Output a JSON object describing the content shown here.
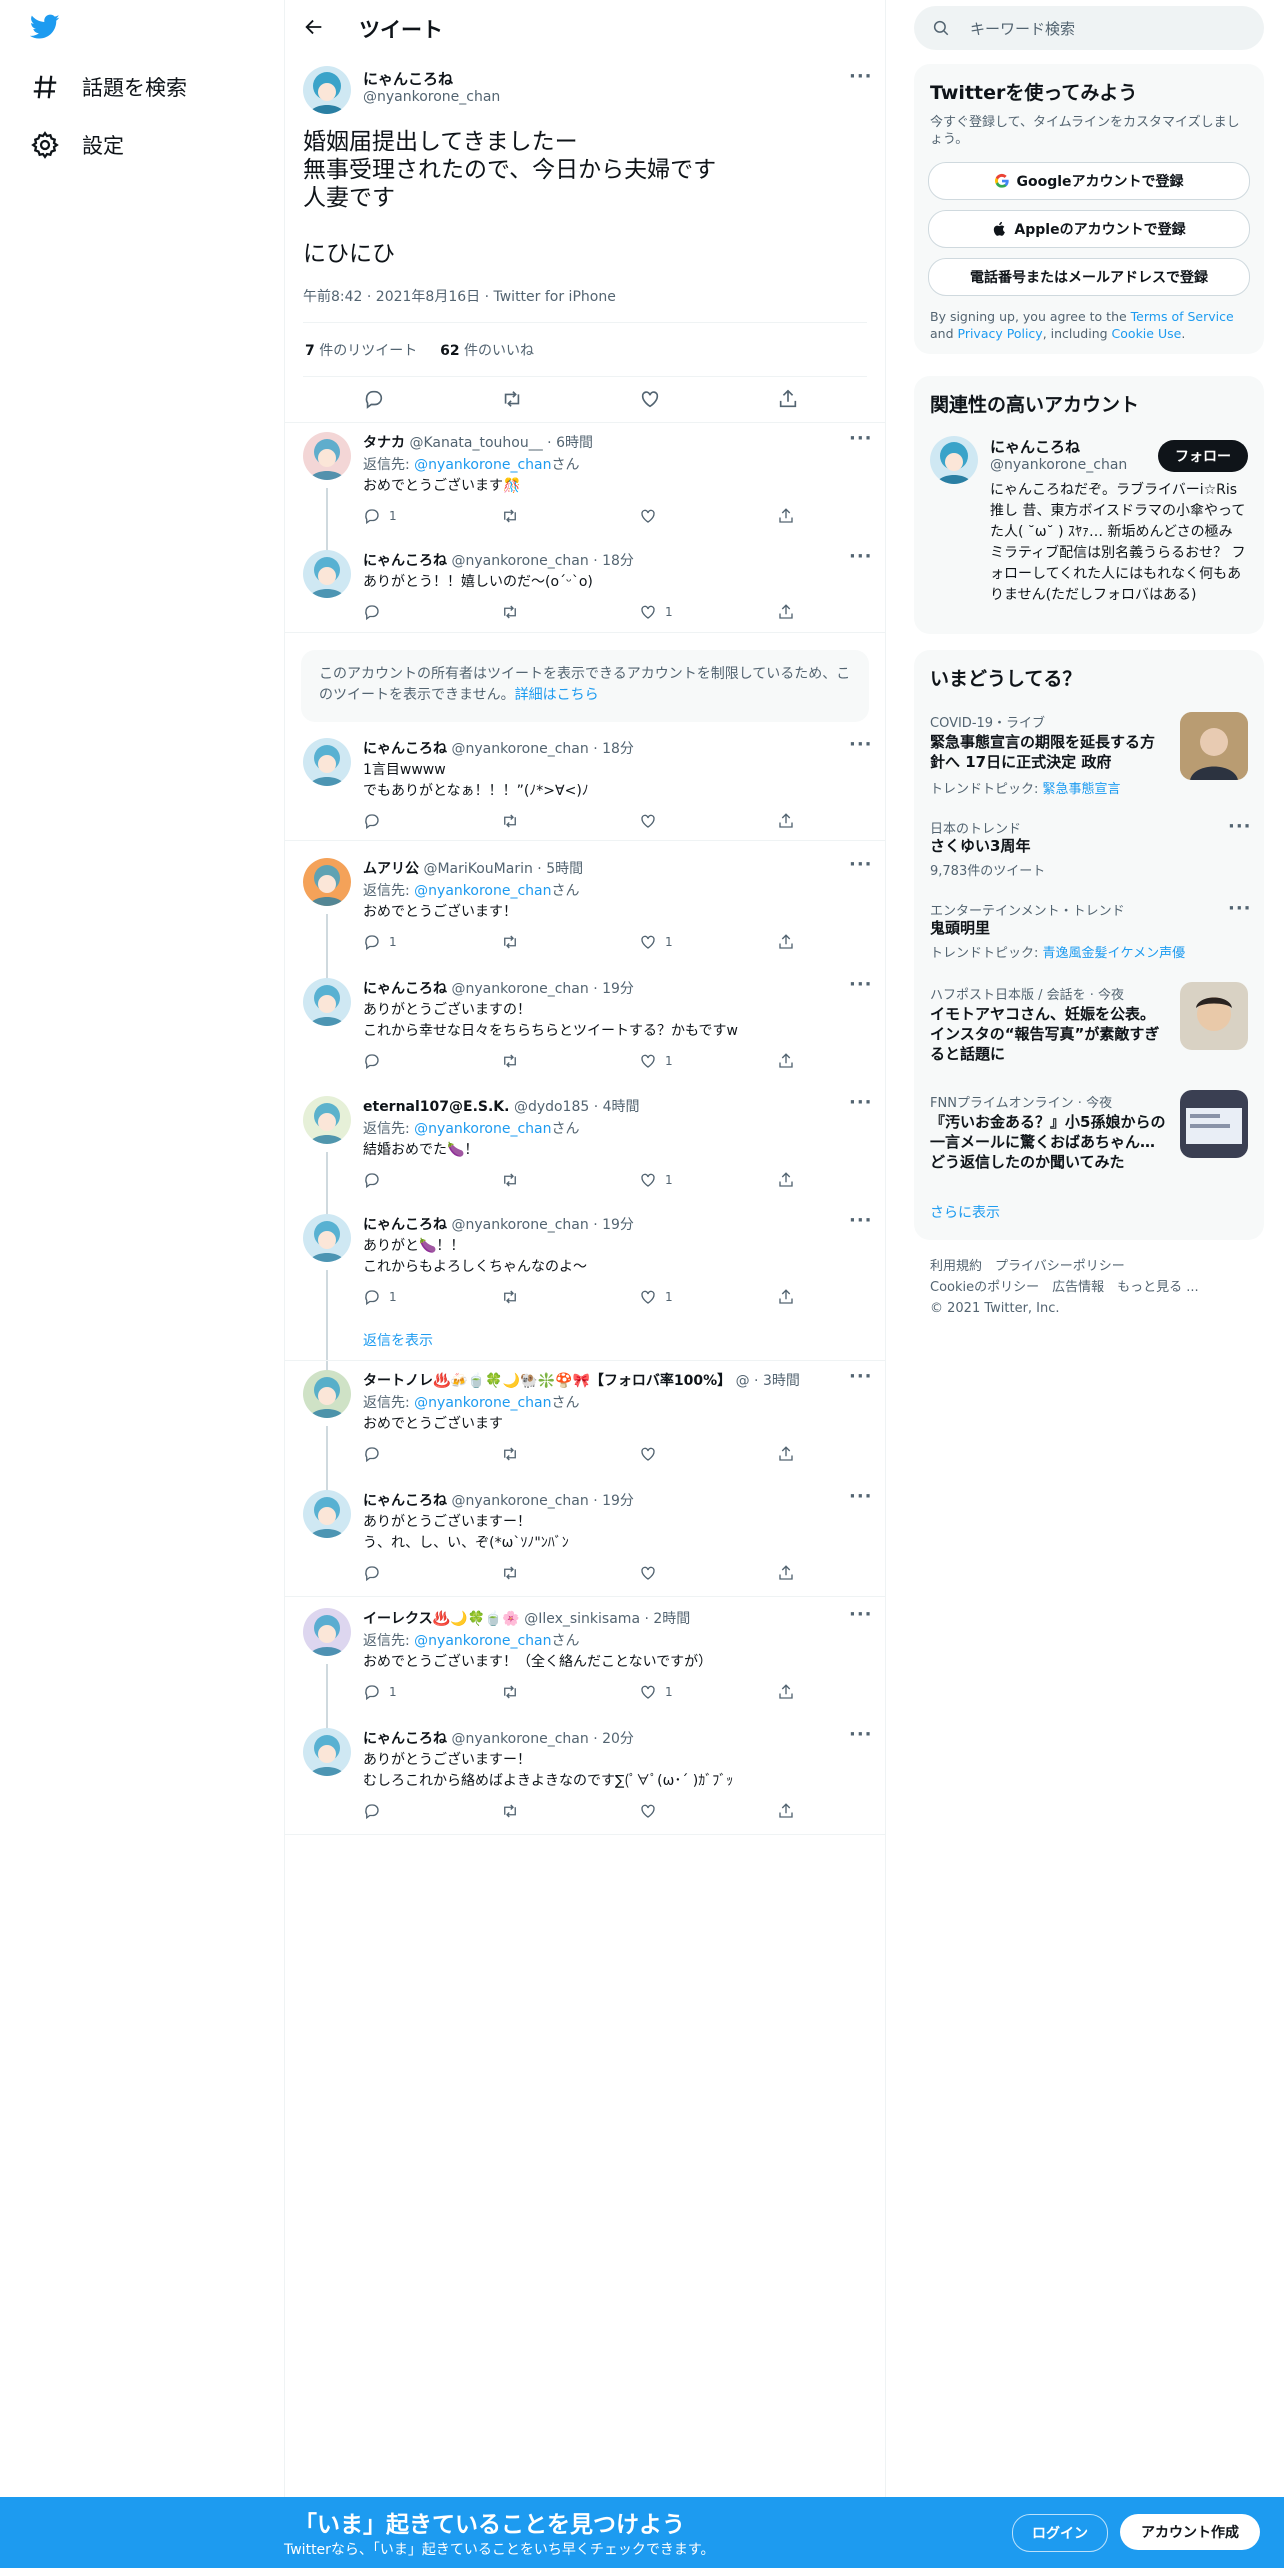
{
  "nav": {
    "logo": "twitter-bird",
    "items": [
      {
        "icon": "hashtag-icon",
        "label": "話題を検索"
      },
      {
        "icon": "gear-icon",
        "label": "設定"
      }
    ]
  },
  "header": {
    "title": "ツイート"
  },
  "main_tweet": {
    "name": "にゃんころね",
    "handle": "@nyankorone_chan",
    "text": "婚姻届提出してきましたー\n無事受理されたので、今日から夫婦です\n人妻です\n\nにひにひ",
    "time": "午前8:42 · 2021年8月16日 · Twitter for iPhone",
    "retweets": "7",
    "retweets_label": " 件のリツイート",
    "likes": "62",
    "likes_label": " 件のいいね"
  },
  "reply_to_label": "返信先: ",
  "reply_to_handle": "@nyankorone_chan",
  "reply_to_suffix": "さん",
  "replies": [
    {
      "name": "タナカ",
      "handle": "@Kanata_touhou__ · 6時間",
      "has_replyto": true,
      "text": "おめでとうございます🎊",
      "reply": "1",
      "retweet": "",
      "like": ""
    },
    {
      "name": "にゃんころね",
      "handle": "@nyankorone_chan · 18分",
      "has_replyto": false,
      "text": "ありがとう！！嬉しいのだ〜(o´ᵕ`o)",
      "reply": "",
      "retweet": "",
      "like": "1"
    },
    {
      "name": "にゃんころね",
      "handle": "@nyankorone_chan · 18分",
      "has_replyto": false,
      "text": "1言目wwww\nでもありがとなぁ！！！”(ﾉ*>∀<)ﾉ",
      "reply": "",
      "retweet": "",
      "like": ""
    },
    {
      "name": "ムアリ公",
      "handle": "@MariKouMarin · 5時間",
      "has_replyto": true,
      "text": "おめでとうございます！",
      "reply": "1",
      "retweet": "",
      "like": "1"
    },
    {
      "name": "にゃんころね",
      "handle": "@nyankorone_chan · 19分",
      "has_replyto": false,
      "text": "ありがとうございますの！\nこれから幸せな日々をちらちらとツイートする？かもですw",
      "reply": "",
      "retweet": "",
      "like": "1"
    },
    {
      "name": "eternal107@E.S.K.",
      "handle": "@dydo185 · 4時間",
      "has_replyto": true,
      "text": "結婚おめでた🍆！",
      "reply": "",
      "retweet": "",
      "like": "1"
    },
    {
      "name": "にゃんころね",
      "handle": "@nyankorone_chan · 19分",
      "has_replyto": false,
      "text": "ありがと🍆！！\nこれからもよろしくちゃんなのよ〜",
      "reply": "1",
      "retweet": "",
      "like": "1"
    },
    {
      "name": "タートノレ♨️🍻🍵🍀🌙🐏❇️🍄🎀【フォロバ率100%】",
      "handle": "@ · 3時間",
      "has_replyto": true,
      "text": "おめでとうございます",
      "reply": "",
      "retweet": "",
      "like": ""
    },
    {
      "name": "にゃんころね",
      "handle": "@nyankorone_chan · 19分",
      "has_replyto": false,
      "text": "ありがとうございますー！\nう、れ、し、い、ぞ(*ω`ｿﾉ\"ﾝﾊﾞﾝ",
      "reply": "",
      "retweet": "",
      "like": ""
    },
    {
      "name": "イーレクス♨️🌙🍀🍵🌸",
      "handle": "@Ilex_sinkisama · 2時間",
      "has_replyto": true,
      "text": "おめでとうございます！（全く絡んだことないですが）",
      "reply": "1",
      "retweet": "",
      "like": "1"
    },
    {
      "name": "にゃんころね",
      "handle": "@nyankorone_chan · 20分",
      "has_replyto": false,
      "text": "ありがとうございますー！\nむしろこれから絡めばよきよきなのです∑(ﾟ∀ﾟ(ω･´ )ｶﾞﾌﾞｯ",
      "reply": "",
      "retweet": "",
      "like": ""
    }
  ],
  "notice": {
    "text": "このアカウントの所有者はツイートを表示できるアカウントを制限しているため、このツイートを表示できません。",
    "link": "詳細はこちら"
  },
  "show_replies": "返信を表示",
  "search": {
    "placeholder": "キーワード検索"
  },
  "signup_card": {
    "title": "Twitterを使ってみよう",
    "subtitle": "今すぐ登録して、タイムラインをカスタマイズしましょう。",
    "google": "Googleアカウントで登録",
    "apple": "Appleのアカウントで登録",
    "phone": "電話番号またはメールアドレスで登録",
    "terms_pre": "By signing up, you agree to the ",
    "terms_link": "Terms of Service",
    "terms_and": " and ",
    "privacy_link": "Privacy Policy",
    "terms_mid": ", including ",
    "cookie_link": "Cookie Use",
    "terms_end": "."
  },
  "related": {
    "title": "関連性の高いアカウント",
    "name": "にゃんころね",
    "handle": "@nyankorone_chan",
    "follow": "フォロー",
    "bio": "にゃんころねだぞ。ラブライバーi☆Ris推し 昔、東方ボイスドラマの小傘やってた人( ˘ω˘ ) ｽﾔｧ… 新垢めんどさの極み ミラティブ配信は別名義うらるおせ？ フォローしてくれた人にはもれなく何もありません(ただしフォロバはある)"
  },
  "trends": {
    "title": "いまどうしてる？",
    "items": [
      {
        "category": "COVID-19・ライブ",
        "title": "緊急事態宣言の期限を延長する方針へ 17日に正式決定 政府",
        "sub_label": "トレンドトピック: ",
        "sub_link": "緊急事態宣言"
      },
      {
        "category": "日本のトレンド",
        "title": "さくゆい3周年",
        "sub_label": "9,783件のツイート",
        "sub_link": ""
      },
      {
        "category": "エンターテインメント・トレンド",
        "title": "鬼頭明里",
        "sub_label": "トレンドトピック: ",
        "sub_link": "青逸風金髪イケメン声優"
      },
      {
        "category": "ハフポスト日本版 / 会話を · 今夜",
        "title": "イモトアヤコさん、妊娠を公表。インスタの“報告写真”が素敵すぎると話題に",
        "sub_label": "",
        "sub_link": ""
      },
      {
        "category": "FNNプライムオンライン · 今夜",
        "title": "『汚いお金ある？』小5孫娘からの一言メールに驚くおばあちゃん…どう返信したのか聞いてみた",
        "sub_label": "",
        "sub_link": ""
      }
    ],
    "more": "さらに表示"
  },
  "footer": {
    "line1": "利用規約　プライバシーポリシー",
    "line2": "Cookieのポリシー　広告情報　もっと見る ...",
    "line3": "© 2021 Twitter, Inc."
  },
  "bottombar": {
    "title": "「いま」起きていることを見つけよう",
    "subtitle": "Twitterなら、「いま」起きていることをいち早くチェックできます。",
    "login": "ログイン",
    "signup": "アカウント作成"
  },
  "colors": {
    "accent": "#1d9bf0",
    "text": "#0f1419",
    "secondary": "#536471"
  }
}
